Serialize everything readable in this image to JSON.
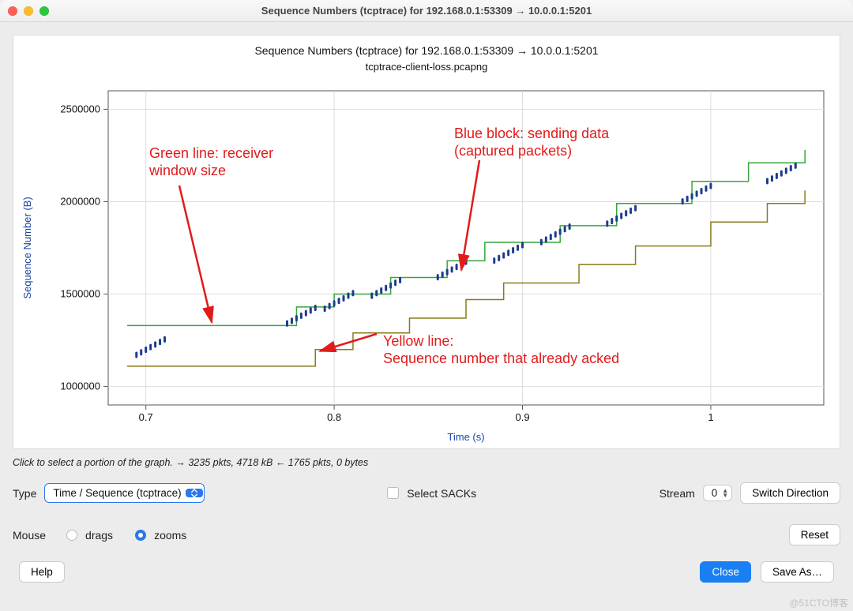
{
  "window": {
    "title": "Sequence Numbers (tcptrace) for 192.168.0.1:53309 → 10.0.0.1:5201"
  },
  "chart_data": {
    "type": "line",
    "title": "Sequence Numbers (tcptrace) for 192.168.0.1:53309 → 10.0.0.1:5201",
    "subtitle": "tcptrace-client-loss.pcapng",
    "xlabel": "Time (s)",
    "ylabel": "Sequence Number (B)",
    "xlim": [
      0.68,
      1.06
    ],
    "ylim": [
      900000,
      2600000
    ],
    "xticks": [
      0.7,
      0.8,
      0.9,
      1.0
    ],
    "yticks": [
      1000000,
      1500000,
      2000000,
      2500000
    ],
    "series": [
      {
        "name": "Receiver window (green)",
        "color": "#35a73a",
        "x": [
          0.69,
          0.76,
          0.78,
          0.8,
          0.83,
          0.86,
          0.88,
          0.92,
          0.95,
          0.99,
          1.02,
          1.05
        ],
        "values": [
          1330000,
          1330000,
          1430000,
          1500000,
          1590000,
          1680000,
          1780000,
          1870000,
          1990000,
          2110000,
          2210000,
          2280000
        ]
      },
      {
        "name": "ACKed sequence (yellow)",
        "color": "#8a7b18",
        "x": [
          0.69,
          0.77,
          0.79,
          0.81,
          0.84,
          0.87,
          0.89,
          0.93,
          0.96,
          1.0,
          1.03,
          1.05
        ],
        "values": [
          1110000,
          1110000,
          1200000,
          1290000,
          1370000,
          1470000,
          1560000,
          1660000,
          1760000,
          1890000,
          1990000,
          2060000
        ]
      },
      {
        "name": "Sent data bursts (blue)",
        "color": "#1c3c8d",
        "x": [
          0.695,
          0.775,
          0.795,
          0.82,
          0.855,
          0.885,
          0.91,
          0.945,
          0.985,
          1.03
        ],
        "values": [
          1160000,
          1330000,
          1410000,
          1480000,
          1580000,
          1670000,
          1770000,
          1870000,
          1990000,
          2100000
        ]
      }
    ],
    "annotations": [
      {
        "text": "Green line: receiver window size",
        "points_to": {
          "series": 0,
          "x": 0.74
        }
      },
      {
        "text": "Yellow line: Sequence number that already acked",
        "points_to": {
          "series": 1,
          "x": 0.79
        }
      },
      {
        "text": "Blue block: sending data (captured packets)",
        "points_to": {
          "series": 2,
          "x": 0.865
        }
      }
    ]
  },
  "hint_text": "Click to select a portion of the graph. → 3235 pkts, 4718 kB ← 1765 pkts, 0 bytes",
  "controls": {
    "type_label": "Type",
    "type_value": "Time / Sequence (tcptrace)",
    "select_sacks_label": "Select SACKs",
    "stream_label": "Stream",
    "stream_value": "0",
    "switch_direction": "Switch Direction",
    "mouse_label": "Mouse",
    "mouse_drags": "drags",
    "mouse_zooms": "zooms",
    "reset": "Reset",
    "help": "Help",
    "close": "Close",
    "save_as": "Save As…"
  },
  "watermark": "@51CTO博客"
}
